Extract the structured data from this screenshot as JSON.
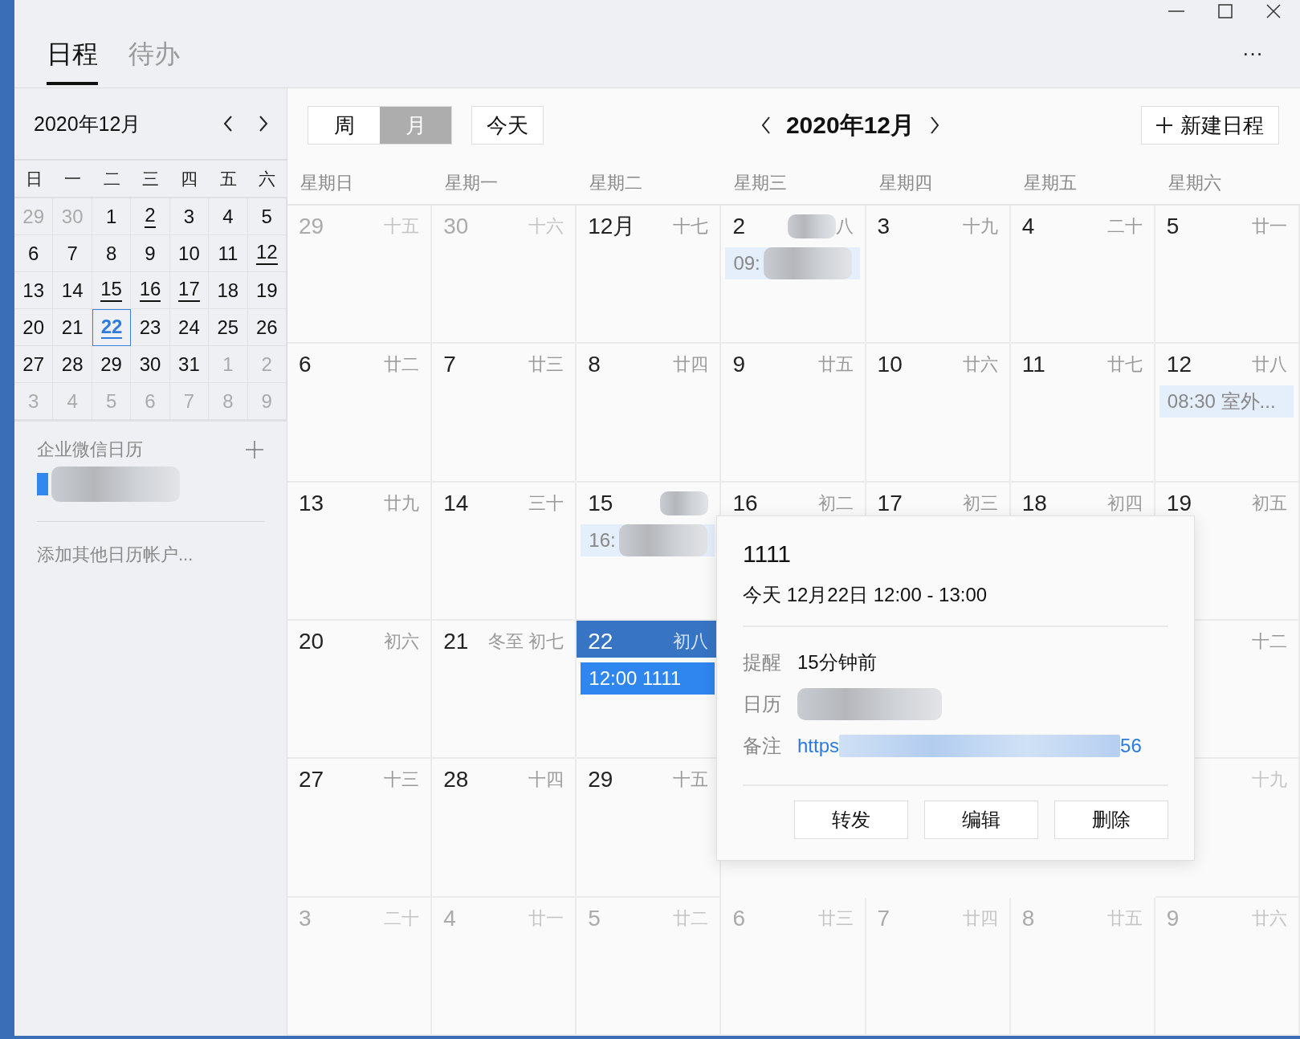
{
  "tabs": [
    {
      "label": "日程",
      "selected": true
    },
    {
      "label": "待办",
      "selected": false
    }
  ],
  "menu_button": "···",
  "mini_calendar": {
    "title": "2020年12月",
    "weekdays": [
      "日",
      "一",
      "二",
      "三",
      "四",
      "五",
      "六"
    ],
    "days": [
      {
        "d": "29",
        "other_month": true,
        "has_events": false,
        "today": false
      },
      {
        "d": "30",
        "other_month": true,
        "has_events": false,
        "today": false
      },
      {
        "d": "1",
        "other_month": false,
        "has_events": false,
        "today": false
      },
      {
        "d": "2",
        "other_month": false,
        "has_events": true,
        "today": false
      },
      {
        "d": "3",
        "other_month": false,
        "has_events": false,
        "today": false
      },
      {
        "d": "4",
        "other_month": false,
        "has_events": false,
        "today": false
      },
      {
        "d": "5",
        "other_month": false,
        "has_events": false,
        "today": false
      },
      {
        "d": "6",
        "other_month": false,
        "has_events": false,
        "today": false
      },
      {
        "d": "7",
        "other_month": false,
        "has_events": false,
        "today": false
      },
      {
        "d": "8",
        "other_month": false,
        "has_events": false,
        "today": false
      },
      {
        "d": "9",
        "other_month": false,
        "has_events": false,
        "today": false
      },
      {
        "d": "10",
        "other_month": false,
        "has_events": false,
        "today": false
      },
      {
        "d": "11",
        "other_month": false,
        "has_events": false,
        "today": false
      },
      {
        "d": "12",
        "other_month": false,
        "has_events": true,
        "today": false
      },
      {
        "d": "13",
        "other_month": false,
        "has_events": false,
        "today": false
      },
      {
        "d": "14",
        "other_month": false,
        "has_events": false,
        "today": false
      },
      {
        "d": "15",
        "other_month": false,
        "has_events": true,
        "today": false
      },
      {
        "d": "16",
        "other_month": false,
        "has_events": true,
        "today": false
      },
      {
        "d": "17",
        "other_month": false,
        "has_events": true,
        "today": false
      },
      {
        "d": "18",
        "other_month": false,
        "has_events": false,
        "today": false
      },
      {
        "d": "19",
        "other_month": false,
        "has_events": false,
        "today": false
      },
      {
        "d": "20",
        "other_month": false,
        "has_events": false,
        "today": false
      },
      {
        "d": "21",
        "other_month": false,
        "has_events": false,
        "today": false
      },
      {
        "d": "22",
        "other_month": false,
        "has_events": true,
        "today": true
      },
      {
        "d": "23",
        "other_month": false,
        "has_events": false,
        "today": false
      },
      {
        "d": "24",
        "other_month": false,
        "has_events": false,
        "today": false
      },
      {
        "d": "25",
        "other_month": false,
        "has_events": false,
        "today": false
      },
      {
        "d": "26",
        "other_month": false,
        "has_events": false,
        "today": false
      },
      {
        "d": "27",
        "other_month": false,
        "has_events": false,
        "today": false
      },
      {
        "d": "28",
        "other_month": false,
        "has_events": false,
        "today": false
      },
      {
        "d": "29",
        "other_month": false,
        "has_events": false,
        "today": false
      },
      {
        "d": "30",
        "other_month": false,
        "has_events": false,
        "today": false
      },
      {
        "d": "31",
        "other_month": false,
        "has_events": false,
        "today": false
      },
      {
        "d": "1",
        "other_month": true,
        "has_events": false,
        "today": false
      },
      {
        "d": "2",
        "other_month": true,
        "has_events": false,
        "today": false
      },
      {
        "d": "3",
        "other_month": true,
        "has_events": false,
        "today": false
      },
      {
        "d": "4",
        "other_month": true,
        "has_events": false,
        "today": false
      },
      {
        "d": "5",
        "other_month": true,
        "has_events": false,
        "today": false
      },
      {
        "d": "6",
        "other_month": true,
        "has_events": false,
        "today": false
      },
      {
        "d": "7",
        "other_month": true,
        "has_events": false,
        "today": false
      },
      {
        "d": "8",
        "other_month": true,
        "has_events": false,
        "today": false
      },
      {
        "d": "9",
        "other_month": true,
        "has_events": false,
        "today": false
      }
    ]
  },
  "calendars": {
    "heading": "企业微信日历",
    "items": [
      {
        "checked": true,
        "redacted": true
      }
    ],
    "add_account": "添加其他日历帐户..."
  },
  "toolbar": {
    "views": [
      {
        "label": "周",
        "selected": false
      },
      {
        "label": "月",
        "selected": true
      }
    ],
    "today_button": "今天",
    "title": "2020年12月",
    "new_button": "新建日程"
  },
  "weekdays": [
    "星期日",
    "星期一",
    "星期二",
    "星期三",
    "星期四",
    "星期五",
    "星期六"
  ],
  "month_days": [
    {
      "date": "29",
      "lunar": "十五",
      "other_month": true,
      "today": false
    },
    {
      "date": "30",
      "lunar": "十六",
      "other_month": true,
      "today": false
    },
    {
      "date": "12月",
      "lunar": "十七",
      "other_month": false,
      "today": false
    },
    {
      "date": "2",
      "lunar": "八",
      "lunar_redacted": true,
      "other_month": false,
      "today": false,
      "events": [
        {
          "time": "09:",
          "redacted": true,
          "selected": false
        }
      ]
    },
    {
      "date": "3",
      "lunar": "十九",
      "other_month": false,
      "today": false
    },
    {
      "date": "4",
      "lunar": "二十",
      "other_month": false,
      "today": false
    },
    {
      "date": "5",
      "lunar": "廿一",
      "other_month": false,
      "today": false
    },
    {
      "date": "6",
      "lunar": "廿二",
      "other_month": false,
      "today": false
    },
    {
      "date": "7",
      "lunar": "廿三",
      "other_month": false,
      "today": false
    },
    {
      "date": "8",
      "lunar": "廿四",
      "other_month": false,
      "today": false
    },
    {
      "date": "9",
      "lunar": "廿五",
      "other_month": false,
      "today": false
    },
    {
      "date": "10",
      "lunar": "廿六",
      "other_month": false,
      "today": false
    },
    {
      "date": "11",
      "lunar": "廿七",
      "other_month": false,
      "today": false
    },
    {
      "date": "12",
      "lunar": "廿八",
      "other_month": false,
      "today": false,
      "events": [
        {
          "time": "08:30",
          "title": "室外...",
          "redacted": false,
          "selected": false
        }
      ]
    },
    {
      "date": "13",
      "lunar": "廿九",
      "other_month": false,
      "today": false
    },
    {
      "date": "14",
      "lunar": "三十",
      "other_month": false,
      "today": false
    },
    {
      "date": "15",
      "lunar_redacted": true,
      "other_month": false,
      "today": false,
      "events": [
        {
          "time": "16:",
          "redacted": true,
          "selected": false
        }
      ]
    },
    {
      "date": "16",
      "lunar": "初二",
      "other_month": false,
      "today": false
    },
    {
      "date": "17",
      "lunar": "初三",
      "other_month": false,
      "today": false
    },
    {
      "date": "18",
      "lunar": "初四",
      "other_month": false,
      "today": false
    },
    {
      "date": "19",
      "lunar": "初五",
      "other_month": false,
      "today": false
    },
    {
      "date": "20",
      "lunar": "初六",
      "other_month": false,
      "today": false
    },
    {
      "date": "21",
      "lunar": "冬至 初七",
      "other_month": false,
      "today": false
    },
    {
      "date": "22",
      "lunar": "初八",
      "other_month": false,
      "today": true,
      "events": [
        {
          "time": "12:00",
          "title": "1111",
          "redacted": false,
          "selected": true
        }
      ]
    },
    {
      "covered": true
    },
    {
      "covered": true
    },
    {
      "covered": true
    },
    {
      "lunar": "十二",
      "other_month": false,
      "today": false
    },
    {
      "date": "27",
      "lunar": "十三",
      "other_month": false,
      "today": false
    },
    {
      "date": "28",
      "lunar": "十四",
      "other_month": false,
      "today": false
    },
    {
      "date": "29",
      "lunar": "十五",
      "other_month": false,
      "today": false
    },
    {
      "covered": true
    },
    {
      "covered": true
    },
    {
      "covered": true
    },
    {
      "lunar": "十九",
      "other_month": true,
      "today": false
    },
    {
      "date": "3",
      "lunar": "二十",
      "other_month": true,
      "today": false
    },
    {
      "date": "4",
      "lunar": "廿一",
      "other_month": true,
      "today": false
    },
    {
      "date": "5",
      "lunar": "廿二",
      "other_month": true,
      "today": false
    },
    {
      "date": "6",
      "lunar": "廿三",
      "other_month": true,
      "today": false
    },
    {
      "date": "7",
      "lunar": "廿四",
      "other_month": true,
      "today": false
    },
    {
      "date": "8",
      "lunar": "廿五",
      "other_month": true,
      "today": false
    },
    {
      "date": "9",
      "lunar": "廿六",
      "other_month": true,
      "today": false
    }
  ],
  "popup": {
    "title": "1111",
    "time": "今天 12月22日 12:00 - 13:00",
    "details": [
      {
        "label": "提醒",
        "kind": "text",
        "value": "15分钟前"
      },
      {
        "label": "日历",
        "kind": "redacted"
      },
      {
        "label": "备注",
        "kind": "link",
        "value": "https",
        "tail": "56"
      }
    ],
    "buttons": [
      "转发",
      "编辑",
      "删除"
    ]
  }
}
